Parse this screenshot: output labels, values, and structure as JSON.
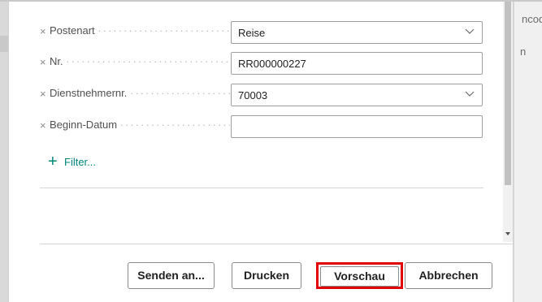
{
  "background": {
    "right_text_1": "ncod",
    "right_text_2": "n"
  },
  "dialog": {
    "fields": [
      {
        "label": "Postenart",
        "value": "Reise",
        "type": "dropdown"
      },
      {
        "label": "Nr.",
        "value": "RR000000227",
        "type": "text"
      },
      {
        "label": "Dienstnehmernr.",
        "value": "70003",
        "type": "dropdown"
      },
      {
        "label": "Beginn-Datum",
        "value": "",
        "type": "text"
      }
    ],
    "remove_glyph": "×",
    "add_filter": {
      "label": "Filter...",
      "icon": "plus-icon"
    },
    "buttons": {
      "send": "Senden an...",
      "print": "Drucken",
      "preview": "Vorschau",
      "cancel": "Abbrechen"
    }
  },
  "colors": {
    "accent": "#00857c",
    "highlight": "#e00000"
  },
  "icons": {
    "dropdown": "chevron-down-icon",
    "remove": "close-icon",
    "scroll_down": "scroll-down-arrow-icon"
  }
}
